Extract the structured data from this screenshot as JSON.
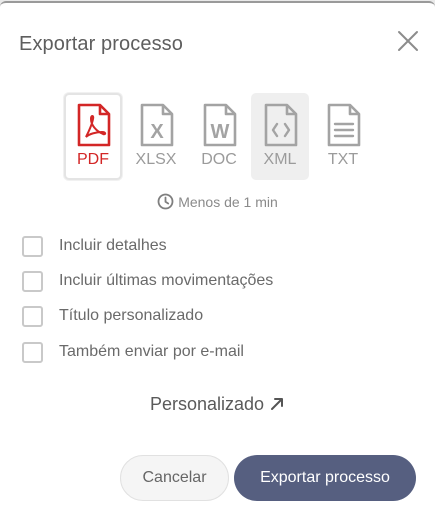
{
  "dialog": {
    "title": "Exportar processo",
    "close_icon": "close-icon"
  },
  "formats": [
    {
      "label": "PDF",
      "icon": "pdf-file-icon",
      "selected": true
    },
    {
      "label": "XLSX",
      "icon": "xlsx-file-icon",
      "selected": false
    },
    {
      "label": "DOC",
      "icon": "doc-file-icon",
      "selected": false
    },
    {
      "label": "XML",
      "icon": "xml-file-icon",
      "selected": false
    },
    {
      "label": "TXT",
      "icon": "txt-file-icon",
      "selected": false
    }
  ],
  "estimate": {
    "icon": "clock-icon",
    "text": "Menos de 1 min"
  },
  "options": [
    {
      "label": "Incluir detalhes",
      "checked": false
    },
    {
      "label": "Incluir últimas movimentações",
      "checked": false
    },
    {
      "label": "Título personalizado",
      "checked": false
    },
    {
      "label": "Também enviar por e-mail",
      "checked": false
    }
  ],
  "custom": {
    "label": "Personalizado",
    "icon": "arrow-up-right-icon"
  },
  "actions": {
    "cancel_label": "Cancelar",
    "export_label": "Exportar processo"
  },
  "colors": {
    "pdf_accent": "#d32626",
    "primary_button": "#565f80",
    "icon_gray": "#a3a3a3"
  }
}
